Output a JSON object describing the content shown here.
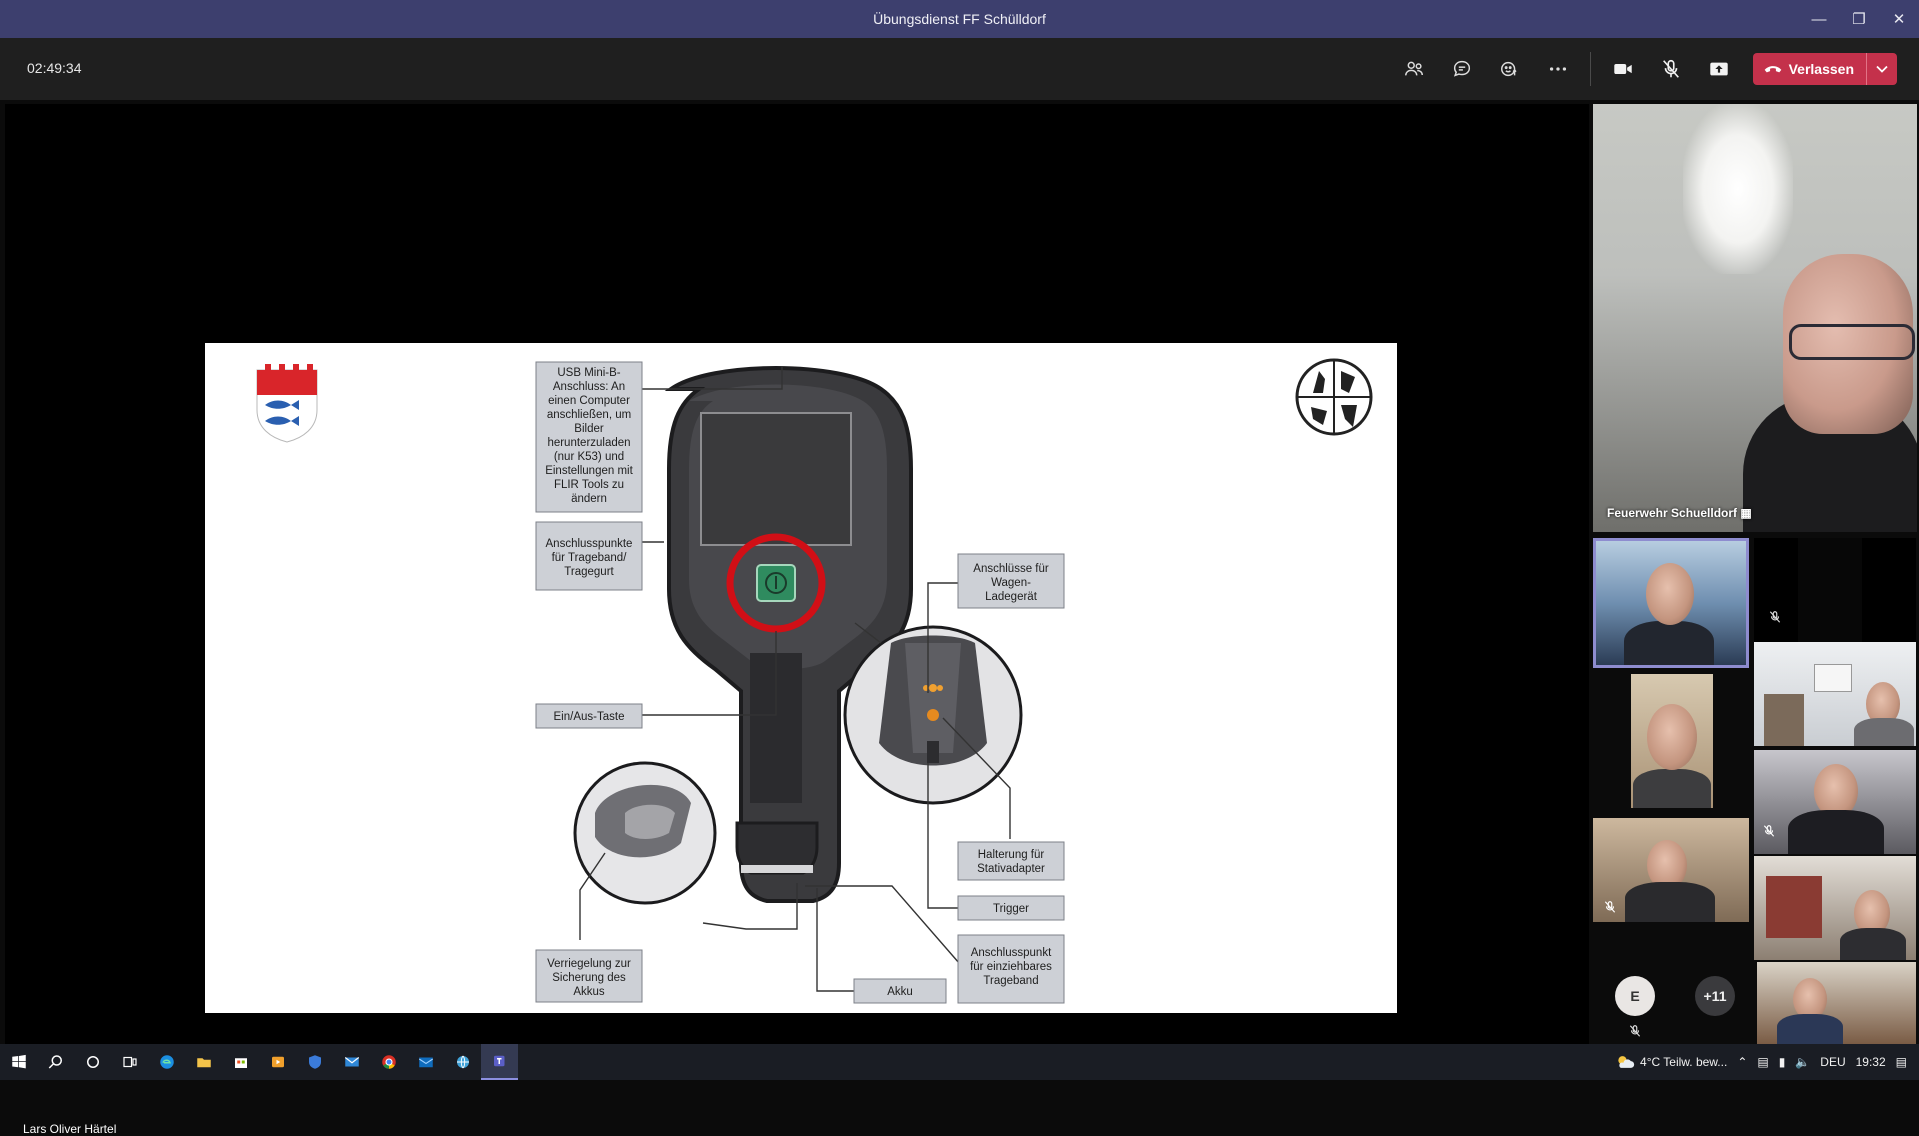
{
  "window": {
    "title": "Übungsdienst FF Schülldorf"
  },
  "meeting": {
    "timer": "02:49:34",
    "leave_label": "Verlassen",
    "presenter_name": "Lars Oliver Härtel",
    "accent": "#c4314b"
  },
  "slide": {
    "labels": {
      "usb": [
        "USB Mini-B-",
        "Anschluss: An",
        "einen Computer",
        "anschließen, um",
        "Bilder",
        "herunterzuladen",
        "(nur K53) und",
        "Einstellungen mit",
        "FLIR Tools zu",
        "ändern"
      ],
      "strap": [
        "Anschlusspunkte",
        "für Trageband/",
        "Tragegurt"
      ],
      "power": [
        "Ein/Aus-Taste"
      ],
      "lock": [
        "Verriegelung zur",
        "Sicherung des",
        "Akkus"
      ],
      "charger": [
        "Anschlüsse für",
        "Wagen-",
        "Ladegerät"
      ],
      "tripod": [
        "Halterung für",
        "Stativadapter"
      ],
      "trigger": [
        "Trigger"
      ],
      "lanyard": [
        "Anschlusspunkt",
        "für einziehbares",
        "Trageband"
      ],
      "battery": [
        "Akku"
      ]
    }
  },
  "participants": {
    "featured_name": "Feuerwehr Schuelldorf",
    "avatar_initial": "E",
    "overflow": "+11"
  },
  "taskbar": {
    "weather": "4°C  Teilw. bew...",
    "lang": "DEU",
    "time": "19:32"
  }
}
